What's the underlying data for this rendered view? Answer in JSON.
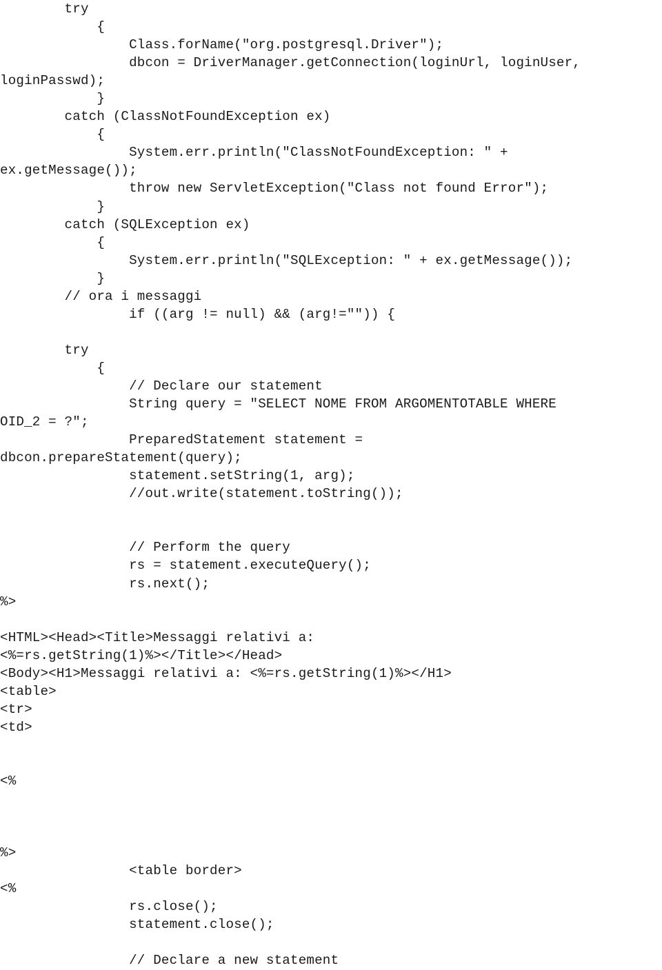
{
  "document": {
    "type": "source-code-listing",
    "language": "JSP / Java",
    "page_background": "#ffffff",
    "text_color": "#1a1a1a"
  },
  "code": {
    "lines": [
      "        try",
      "            {",
      "                Class.forName(\"org.postgresql.Driver\");",
      "                dbcon = DriverManager.getConnection(loginUrl, loginUser,",
      "loginPasswd);",
      "            }",
      "        catch (ClassNotFoundException ex)",
      "            {",
      "                System.err.println(\"ClassNotFoundException: \" +",
      "ex.getMessage());",
      "                throw new ServletException(\"Class not found Error\");",
      "            }",
      "        catch (SQLException ex)",
      "            {",
      "                System.err.println(\"SQLException: \" + ex.getMessage());",
      "            }",
      "        // ora i messaggi",
      "                if ((arg != null) && (arg!=\"\")) {",
      "",
      "        try",
      "            {",
      "                // Declare our statement",
      "                String query = \"SELECT NOME FROM ARGOMENTOTABLE WHERE",
      "OID_2 = ?\";",
      "                PreparedStatement statement =",
      "dbcon.prepareStatement(query);",
      "                statement.setString(1, arg);",
      "                //out.write(statement.toString());",
      "",
      "",
      "                // Perform the query",
      "                rs = statement.executeQuery();",
      "                rs.next();",
      "%>",
      "",
      "<HTML><Head><Title>Messaggi relativi a:",
      "<%=rs.getString(1)%></Title></Head>",
      "<Body><H1>Messaggi relativi a: <%=rs.getString(1)%></H1>",
      "<table>",
      "<tr>",
      "<td>",
      "",
      "",
      "<%",
      "",
      "",
      "",
      "%>",
      "                <table border>",
      "<%",
      "                rs.close();",
      "                statement.close();",
      "",
      "                // Declare a new statement"
    ]
  }
}
